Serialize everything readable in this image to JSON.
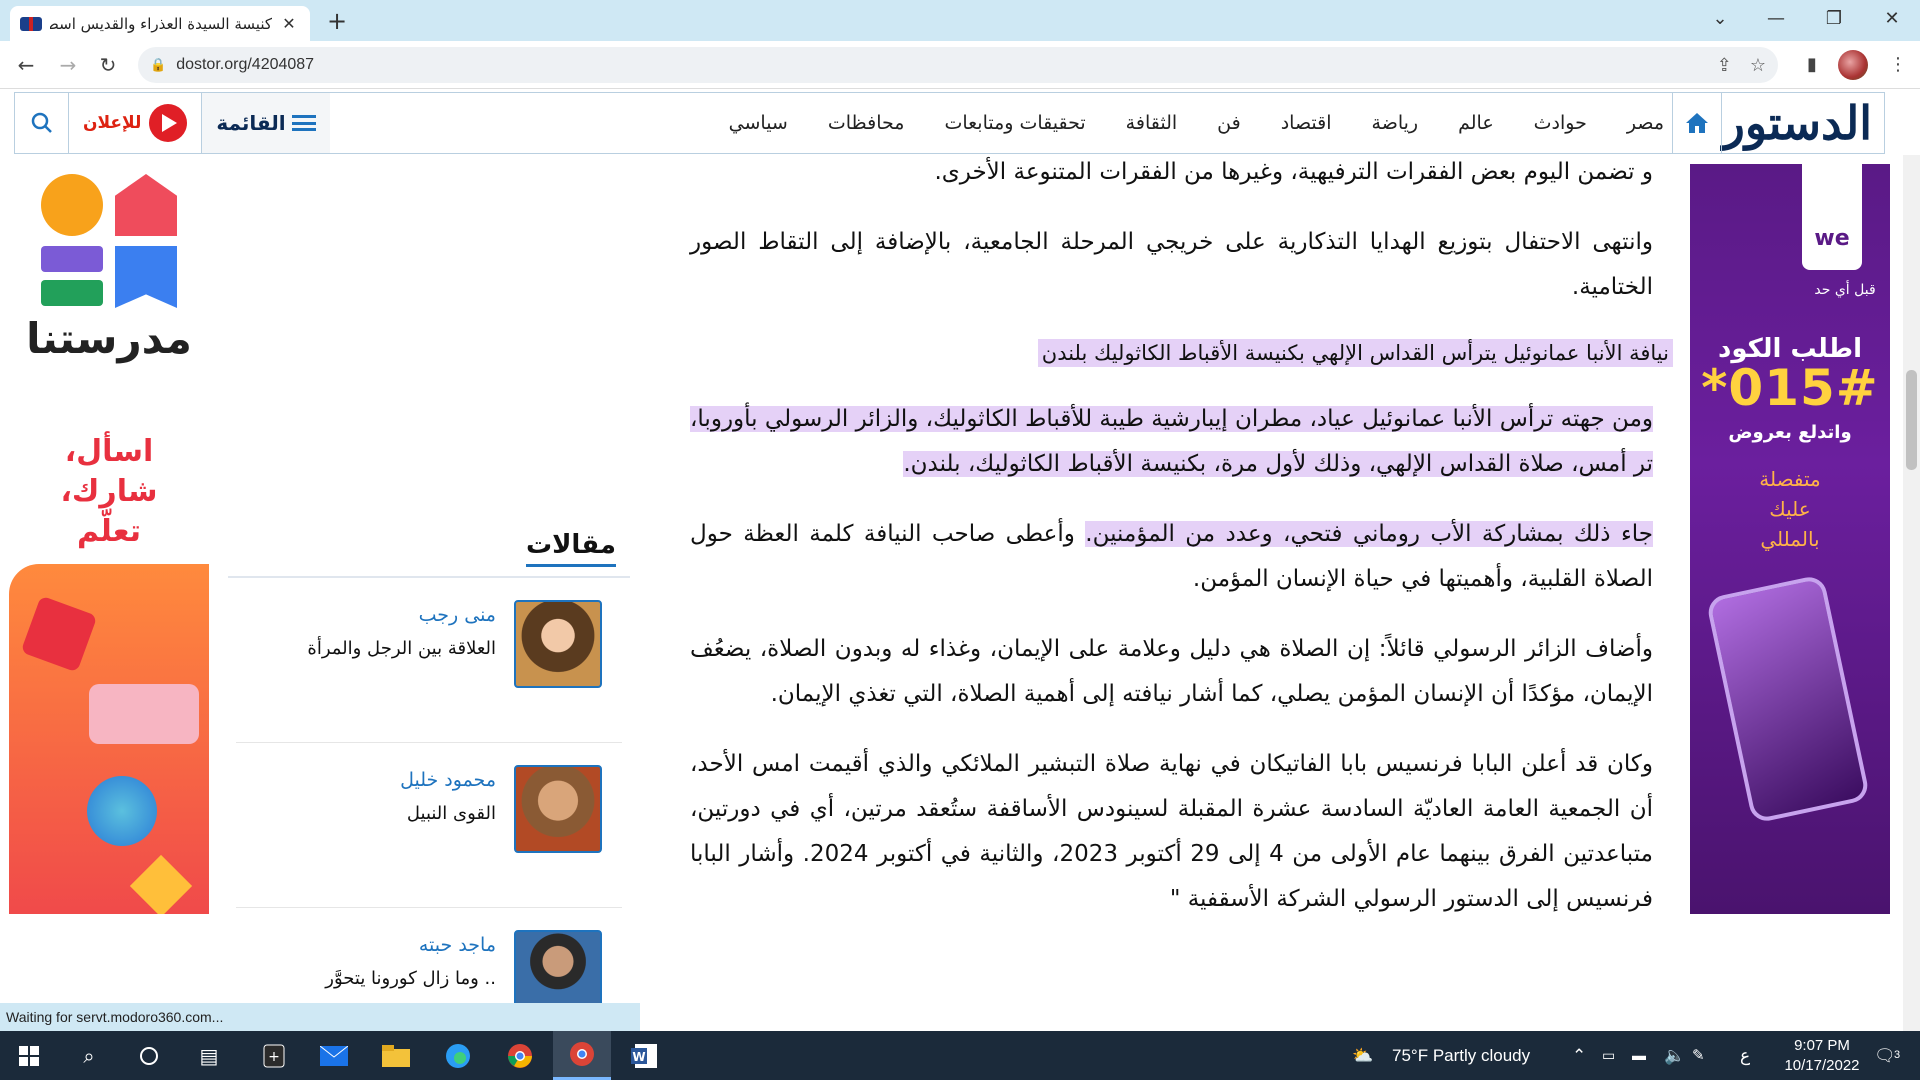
{
  "browser": {
    "tab_title": "كنيسة السيدة العذراء والقديس اسط",
    "tab_close": "✕",
    "new_tab": "+",
    "url": "dostor.org/4204087",
    "status": "Waiting for servt.modoro360.com..."
  },
  "site": {
    "logo": "الدستور",
    "nav": [
      "مصر",
      "حوادث",
      "عالم",
      "رياضة",
      "اقتصاد",
      "فن",
      "الثقافة",
      "تحقيقات ومتابعات",
      "محافظات",
      "سياسي"
    ],
    "menu_label": "القائمة",
    "advertise_label": "للإعلان"
  },
  "article": {
    "p1": "و تضمن اليوم بعض الفقرات الترفيهية، وغيرها من الفقرات المتنوعة الأخرى.",
    "p2": "وانتهى الاحتفال بتوزيع الهدايا التذكارية على خريجي المرحلة الجامعية، بالإضافة إلى التقاط الصور الختامية.",
    "subhead": "نيافة الأنبا عمانوئيل يترأس القداس الإلهي بكنيسة الأقباط الكاثوليك بلندن",
    "p3": "ومن جهته ترأس الأنبا عمانوئيل عياد، مطران إيبارشية طيبة للأقباط الكاثوليك، والزائر الرسولي بأوروبا، تر أمس، صلاة القداس الإلهي، وذلك لأول مرة، بكنيسة الأقباط الكاثوليك، بلندن.",
    "p4_highlight": "جاء ذلك بمشاركة الأب روماني فتحي، وعدد من المؤمنين.",
    "p4_rest": " وأعطى صاحب النيافة كلمة العظة حول الصلاة القلبية، وأهميتها في حياة الإنسان المؤمن.",
    "p5": "وأضاف الزائر الرسولي قائلاً: إن الصلاة هي دليل وعلامة على الإيمان، وغذاء له وبدون الصلاة، يضعُف الإيمان، مؤكدًا أن الإنسان المؤمن يصلي، كما أشار نيافته إلى أهمية الصلاة، التي تغذي الإيمان.",
    "p6": "وكان قد أعلن البابا فرنسيس بابا الفاتيكان في نهاية صلاة التبشير الملائكي والذي أقيمت امس الأحد، أن الجمعية العامة العاديّة السادسة عشرة المقبلة لسينودس الأساقفة ستُعقد مرتين، أي في دورتين، متباعدتين الفرق بينهما عام الأولى من 4 إلى 29 أكتوبر 2023، والثانية في أكتوبر 2024. وأشار البابا فرنسيس إلى الدستور الرسولي الشركة الأسقفية \""
  },
  "sidebar": {
    "heading": "مقالات",
    "writers": [
      {
        "name": "منى رجب",
        "title": "العلاقة بين الرجل والمرأة"
      },
      {
        "name": "محمود خليل",
        "title": "القوى النبيل"
      },
      {
        "name": "ماجد حبته",
        "title": ".. وما زال كورونا يتحوَّر"
      }
    ]
  },
  "ads": {
    "we": {
      "brand": "we",
      "tagline": "قبل أي حد",
      "headline": "اطلب الكود",
      "code": "*015#",
      "sub": "واتدلع بعروض",
      "body": "متفصلة عليك بالمللي"
    },
    "madrasatuna": {
      "brand": "مدرستنا",
      "slogan": "اسأل، شارك، تعلّم"
    }
  },
  "taskbar": {
    "weather": "75°F  Partly cloudy",
    "time": "9:07 PM",
    "date": "10/17/2022",
    "lang": "ع",
    "notif_count": "3"
  },
  "colors": {
    "brand_navy": "#0b2a55",
    "brand_blue": "#1e73be",
    "brand_red": "#e01f26",
    "highlight": "#e5d1f7"
  }
}
